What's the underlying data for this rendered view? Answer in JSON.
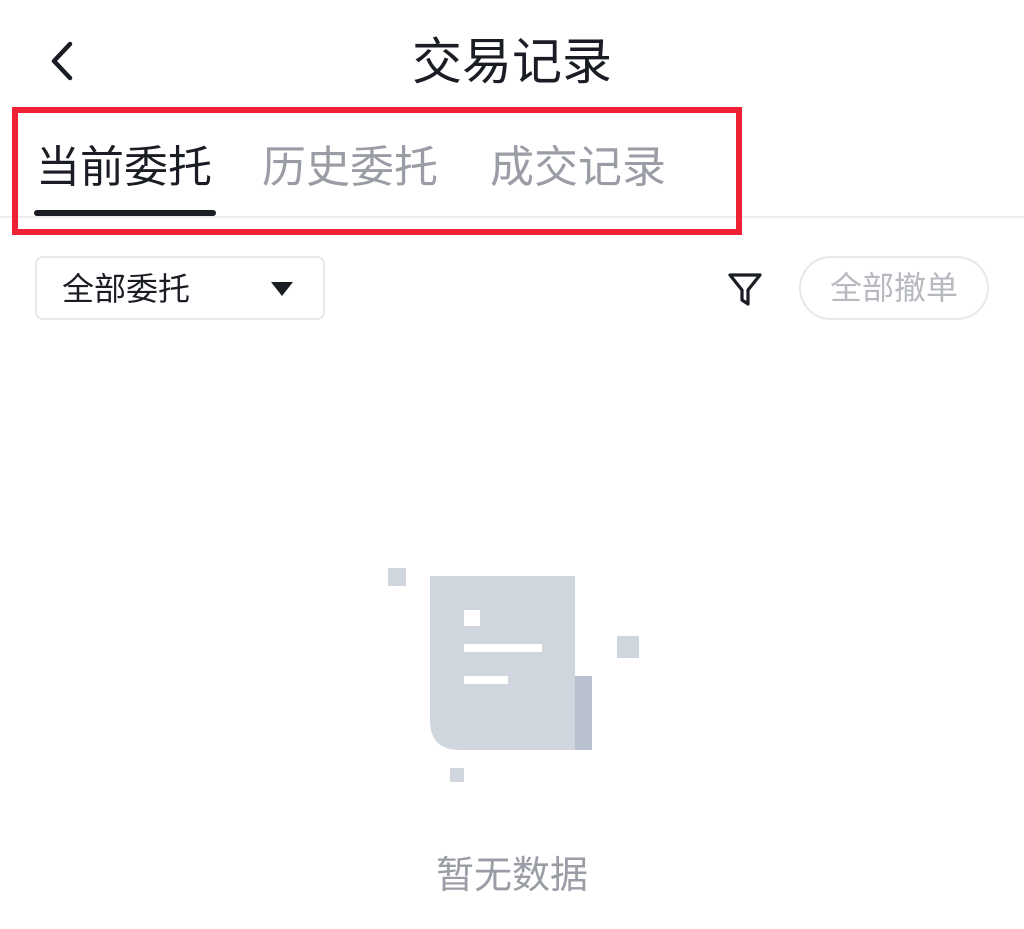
{
  "header": {
    "back_icon": "chevron-left-icon",
    "title": "交易记录"
  },
  "tabs": [
    {
      "label": "当前委托",
      "active": true
    },
    {
      "label": "历史委托",
      "active": false
    },
    {
      "label": "成交记录",
      "active": false
    }
  ],
  "toolbar": {
    "filter_select_value": "全部委托",
    "filter_icon": "filter-icon",
    "cancel_all_label": "全部撤单"
  },
  "empty_state": {
    "icon": "empty-document-icon",
    "text": "暂无数据"
  },
  "colors": {
    "text_primary": "#1b1d24",
    "text_secondary": "#9a9da5",
    "highlight_border": "#ef2235",
    "illustration": "#d0d6de"
  }
}
